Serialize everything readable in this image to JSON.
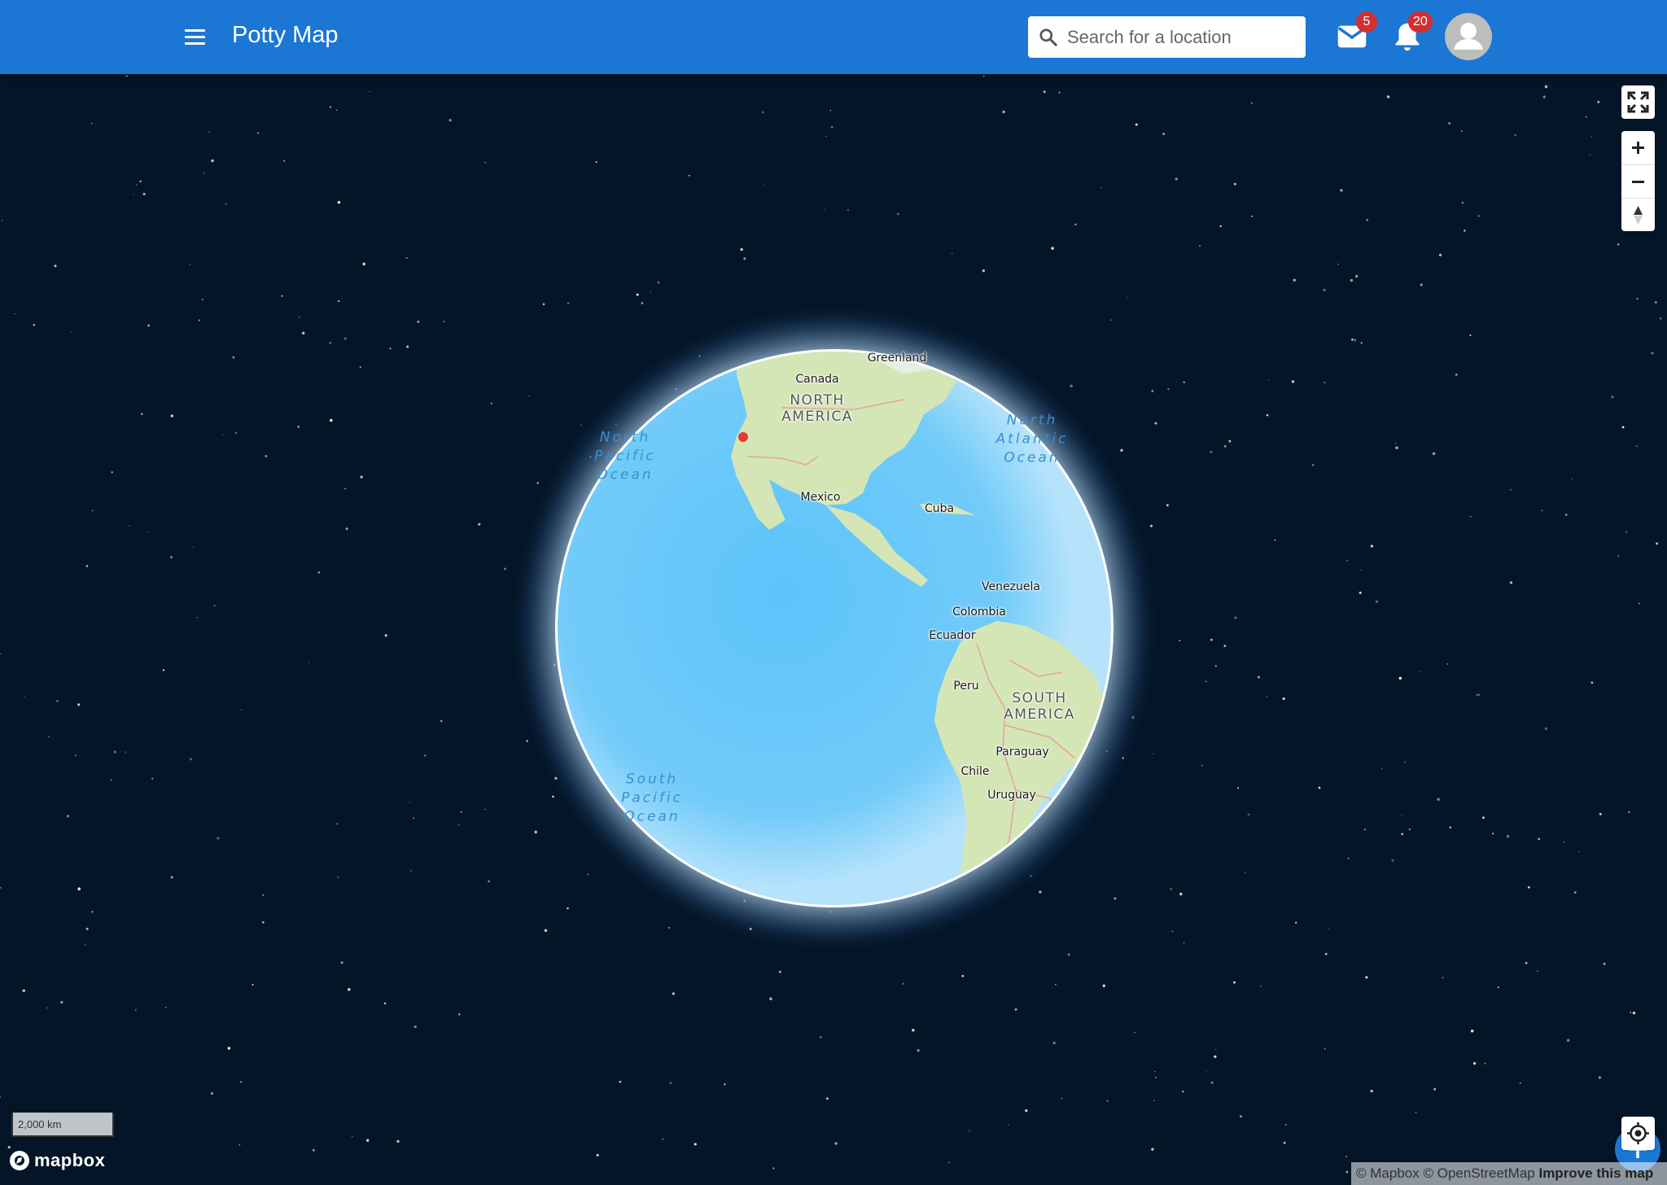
{
  "app": {
    "title": "Potty Map"
  },
  "search": {
    "placeholder": "Search for a location",
    "value": ""
  },
  "header": {
    "mail_badge": "5",
    "notifications_badge": "20"
  },
  "map": {
    "labels": {
      "greenland": "Greenland",
      "canada": "Canada",
      "north_america": "NORTH\nAMERICA",
      "north_pacific": "North\nPacific\nOcean",
      "north_atlantic": "North\nAtlantic\nOcean",
      "mexico": "Mexico",
      "cuba": "Cuba",
      "venezuela": "Venezuela",
      "colombia": "Colombia",
      "ecuador": "Ecuador",
      "peru": "Peru",
      "south_america": "SOUTH\nAMERICA",
      "paraguay": "Paraguay",
      "chile": "Chile",
      "uruguay": "Uruguay",
      "south_pacific": "South\nPacific\nOcean"
    },
    "scale_label": "2,000 km",
    "logo_text": "mapbox",
    "attribution": {
      "mapbox": "© Mapbox",
      "osm": "© OpenStreetMap",
      "improve": "Improve this map"
    },
    "marker_color": "#e53935"
  },
  "colors": {
    "appbar": "#1b76d4",
    "badge": "#d32f2f",
    "space": "#051629",
    "ocean": "#6cc7f8",
    "land": "#d5e6b8"
  },
  "icons": {
    "menu": "menu-icon",
    "search": "search-icon",
    "mail": "mail-icon",
    "bell": "bell-icon",
    "account": "account-icon",
    "fullscreen": "fullscreen-icon",
    "zoom_in": "plus-icon",
    "zoom_out": "minus-icon",
    "compass": "compass-icon",
    "add": "plus-icon",
    "locate": "locate-icon"
  }
}
